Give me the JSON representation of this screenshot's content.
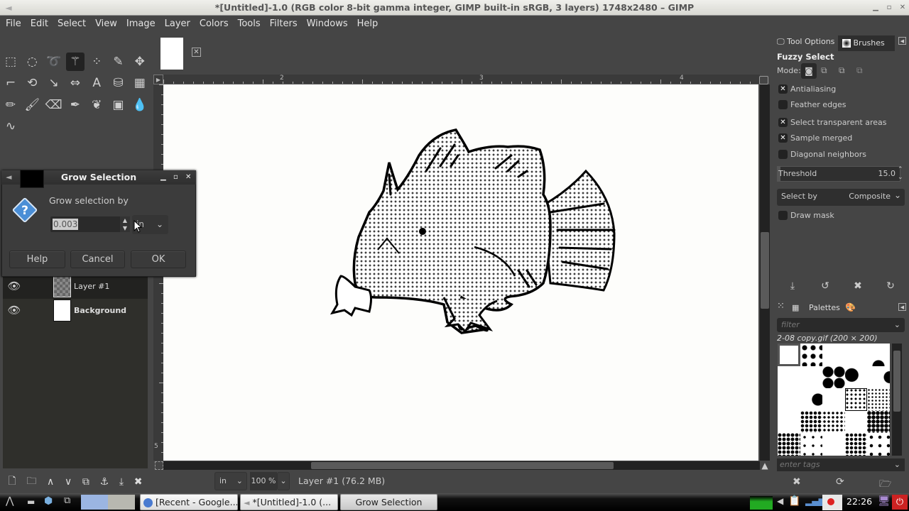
{
  "window": {
    "title": "*[Untitled]-1.0 (RGB color 8-bit gamma integer, GIMP built-in sRGB, 3 layers) 1748x2480 – GIMP",
    "controls": [
      "minimize",
      "maximize",
      "close"
    ]
  },
  "menubar": [
    "File",
    "Edit",
    "Select",
    "View",
    "Image",
    "Layer",
    "Colors",
    "Tools",
    "Filters",
    "Windows",
    "Help"
  ],
  "toolbox": {
    "tools": [
      {
        "name": "rect-select",
        "glyph": "⬚"
      },
      {
        "name": "ellipse-select",
        "glyph": "◌"
      },
      {
        "name": "free-select",
        "glyph": "➰"
      },
      {
        "name": "fuzzy-select",
        "glyph": "⚚",
        "active": true
      },
      {
        "name": "select-by-color",
        "glyph": "⁘"
      },
      {
        "name": "color-picker",
        "glyph": "✎"
      },
      {
        "name": "move",
        "glyph": "✥"
      },
      {
        "name": "crop",
        "glyph": "⌐"
      },
      {
        "name": "transform",
        "glyph": "⟲"
      },
      {
        "name": "warp",
        "glyph": "↘"
      },
      {
        "name": "flip",
        "glyph": "⇔"
      },
      {
        "name": "text",
        "glyph": "A"
      },
      {
        "name": "bucket-fill",
        "glyph": "⛁"
      },
      {
        "name": "gradient",
        "glyph": "▦"
      },
      {
        "name": "pencil",
        "glyph": "✏"
      },
      {
        "name": "paintbrush",
        "glyph": "🖌"
      },
      {
        "name": "eraser",
        "glyph": "⌫"
      },
      {
        "name": "airbrush",
        "glyph": "✒"
      },
      {
        "name": "ink",
        "glyph": "❦"
      },
      {
        "name": "mypaint-brush",
        "glyph": "▣"
      },
      {
        "name": "smudge",
        "glyph": "💧"
      },
      {
        "name": "paths",
        "glyph": "∿"
      }
    ],
    "foreground_color": "#000000",
    "background_color": "#ffffff"
  },
  "image_tab": {
    "close_glyph": "✕"
  },
  "rulers": {
    "horizontal_labels": [
      "2",
      "3",
      "4"
    ],
    "vertical_labels": [
      "5"
    ]
  },
  "statusbar": {
    "unit": "in",
    "zoom": "100 %",
    "message": "Layer #1 (76.2 MB)"
  },
  "layers": {
    "items": [
      {
        "name": "Layer #1",
        "visible": true,
        "selected": true
      },
      {
        "name": "Background",
        "visible": true,
        "selected": false
      }
    ],
    "actions": [
      "new-layer",
      "new-layer-group",
      "raise-layer",
      "lower-layer",
      "duplicate-layer",
      "anchor-layer",
      "merge-down",
      "delete-layer"
    ],
    "action_glyphs": [
      "🗋",
      "🗀",
      "∧",
      "∨",
      "⧉",
      "⚓",
      "⤓",
      "✖"
    ]
  },
  "dialog": {
    "title": "Grow Selection",
    "label": "Grow selection by",
    "value": "0.003",
    "unit": "in",
    "buttons": {
      "help": "Help",
      "cancel": "Cancel",
      "ok": "OK"
    }
  },
  "tool_options": {
    "tabs": {
      "tool_options": "Tool Options",
      "brushes": "Brushes"
    },
    "tool_name": "Fuzzy Select",
    "mode_label": "Mode:",
    "options": [
      {
        "label": "Antialiasing",
        "checked": true
      },
      {
        "label": "Feather edges",
        "checked": false
      },
      {
        "label": "Select transparent areas",
        "checked": true
      },
      {
        "label": "Sample merged",
        "checked": true
      },
      {
        "label": "Diagonal neighbors",
        "checked": false
      }
    ],
    "threshold": {
      "label": "Threshold",
      "value": "15.0"
    },
    "select_by": {
      "label": "Select by",
      "value": "Composite"
    },
    "draw_mask": {
      "label": "Draw mask",
      "checked": false
    },
    "footer_glyphs": [
      "⤓",
      "↺",
      "✖",
      "↻"
    ]
  },
  "patterns": {
    "tabs": {
      "palettes": "Palettes"
    },
    "filter_placeholder": "filter",
    "selected_name": "2-08 copy.gif (200 × 200)",
    "tags_placeholder": "enter tags",
    "footer_glyphs": [
      "✖",
      "⟳",
      "🗁"
    ]
  },
  "taskbar": {
    "tasks": [
      {
        "label": "[Recent - Google...",
        "icon": "chrome"
      },
      {
        "label": "*[Untitled]-1.0 (...",
        "icon": "gimp"
      },
      {
        "label": "Grow Selection",
        "active": true
      }
    ],
    "clock": "22:26"
  }
}
